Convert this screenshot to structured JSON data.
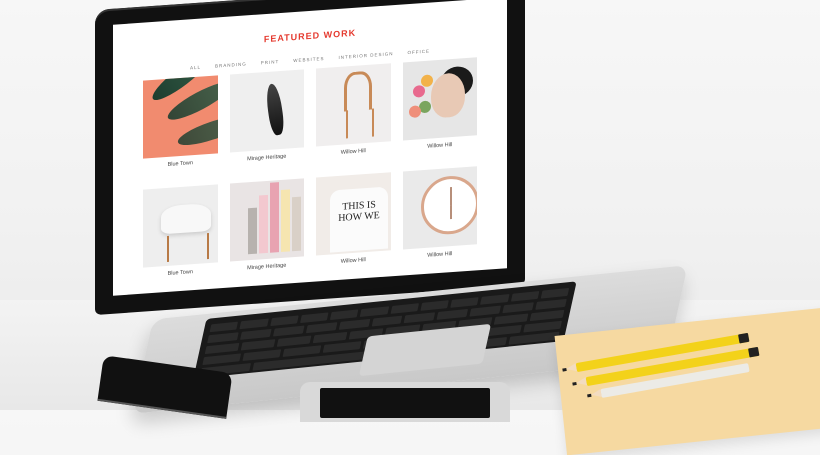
{
  "site": {
    "title": "FEATURED WORK",
    "nav": [
      "ALL",
      "BRANDING",
      "PRINT",
      "WEBSITES",
      "INTERIOR DESIGN",
      "OFFICE"
    ]
  },
  "portfolio": {
    "items": [
      {
        "caption": "Blue Town",
        "icon": "leaves-image"
      },
      {
        "caption": "Mirage Heritage",
        "icon": "feather-image"
      },
      {
        "caption": "Willow Hill",
        "icon": "chair-image"
      },
      {
        "caption": "Willow Hill",
        "icon": "flower-portrait-image"
      },
      {
        "caption": "Blue Town",
        "icon": "eames-chair-image"
      },
      {
        "caption": "Mirage Heritage",
        "icon": "books-image"
      },
      {
        "caption": "Willow Hill",
        "icon": "tshirt-image"
      },
      {
        "caption": "Willow Hill",
        "icon": "clock-image"
      }
    ]
  },
  "shirt_text": "THIS IS HOW WE",
  "colors": {
    "accent": "#e53a2f",
    "pencil": "#f3d21a",
    "paper": "#f6d9a1"
  }
}
